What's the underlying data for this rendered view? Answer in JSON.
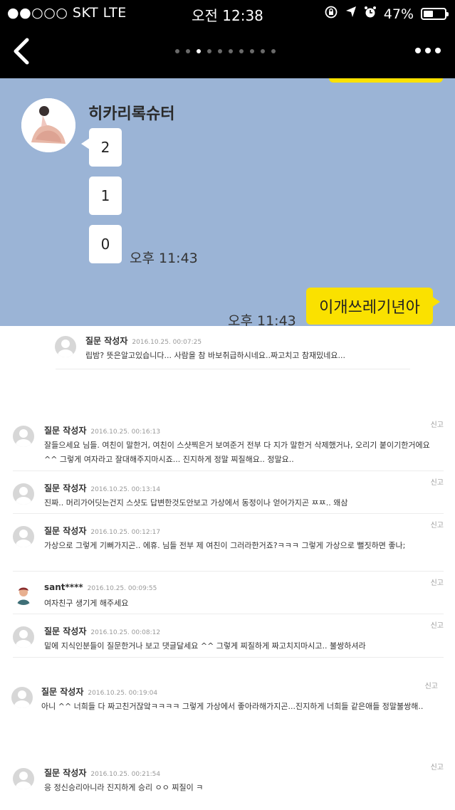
{
  "status_bar": {
    "carrier": "●●○○○ SKT   LTE",
    "time": "오전 12:38",
    "battery": "47%",
    "battery_level": 0.47
  },
  "nav": {
    "page_count": 10,
    "active_index": 2
  },
  "chat": {
    "sender": "히카리록슈터",
    "messages": [
      "2",
      "1",
      "0"
    ],
    "received_time": "오후 11:43",
    "sent_message": "이개쓰레기년아",
    "sent_time": "오후 11:43"
  },
  "comments": [
    {
      "author": "질문 작성자",
      "date": "2016.10.25. 00:07:25",
      "text": "립밤? 뜻은알고있습니다... 사람을 참 바보취급하시네요..짜고치고 참재밌네요...",
      "report": ""
    },
    {
      "author": "질문 작성자",
      "date": "2016.10.25. 00:16:13",
      "text": "잘들으세요 님들. 여친이 말한거, 여친이 스샷찍은거 보여준거 전부 다 지가 말한거 삭제했거나, 오리기 붙이기한거에요 ^^ 그렇게 여자라고 잘대해주지마시죠... 진지하게 정말 찌질해요.. 정말요..",
      "report": "신고"
    },
    {
      "author": "질문 작성자",
      "date": "2016.10.25. 00:13:14",
      "text": "진짜.. 머리가어딧는건지 스샷도 답변한것도안보고 가상에서 동정이나 얻어가지곤 ㅉㅉ.. 왜삼",
      "report": "신고"
    },
    {
      "author": "질문 작성자",
      "date": "2016.10.25. 00:12:17",
      "text": "가상으로 그렇게 기뻐가지곤.. 에휴. 님들 전부 제 여친이 그러라한거죠?ㅋㅋㅋ 그렇게 가상으로 뻘짓하면 좋나;",
      "report": "신고"
    },
    {
      "author": "sant****",
      "date": "2016.10.25. 00:09:55",
      "text": "여자친구 생기게 해주세요",
      "report": "신고"
    },
    {
      "author": "질문 작성자",
      "date": "2016.10.25. 00:08:12",
      "text": "밑에 지식인분들이 질문한거나 보고 댓글달세요 ^^ 그렇게 찌질하게 짜고치지마시고.. 불쌍하셔라",
      "report": "신고"
    },
    {
      "author": "질문 작성자",
      "date": "2016.10.25. 00:19:04",
      "text": "아니 ^^ 너희들 다 짜고친거잖앜ㅋㅋㅋㅋ 그렇게 가상에서 좋아라해가지곤...진지하게 너희들 같은애들 정말불쌍해..",
      "report": "신고"
    },
    {
      "author": "질문 작성자",
      "date": "2016.10.25. 00:21:54",
      "text": "응 정신승리아니라 진지하게 승리 ㅇㅇ 찌질이 ㅋ",
      "report": "신고"
    }
  ]
}
